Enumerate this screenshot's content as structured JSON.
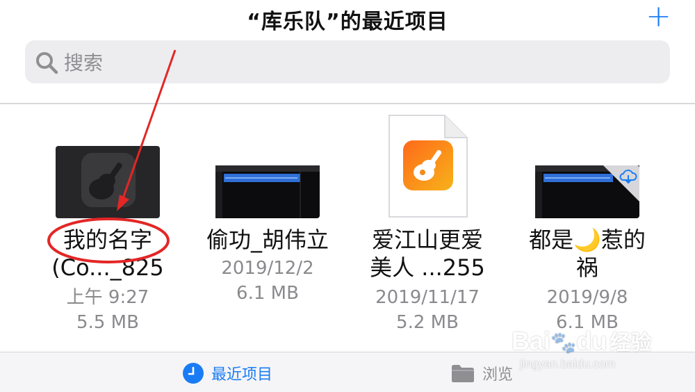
{
  "header": {
    "title": "“库乐队”的最近项目",
    "add_icon": "plus-icon"
  },
  "search": {
    "placeholder": "搜索"
  },
  "files": [
    {
      "name_line1": "我的名字",
      "name_line2": "(Co..._825",
      "date": "上午 9:27",
      "size": "5.5 MB"
    },
    {
      "name_line1": "偷功_胡伟立",
      "name_line2": "",
      "date": "2019/12/2",
      "size": "6.1 MB"
    },
    {
      "name_line1": "爱江山更爱",
      "name_line2": "美人 ...255",
      "date": "2019/11/17",
      "size": "5.2 MB"
    },
    {
      "name_line1": "都是🌙惹的",
      "name_line2": "祸",
      "date": "2019/9/8",
      "size": "6.1 MB"
    }
  ],
  "tabs": {
    "recent": "最近项目",
    "browse": "浏览"
  },
  "watermark": {
    "brand": "Bai",
    "brand_suffix": "du",
    "text": "经验",
    "url": "jingyan.baidu.com"
  },
  "colors": {
    "accent": "#1a7cf5",
    "annotation": "#e32626"
  }
}
